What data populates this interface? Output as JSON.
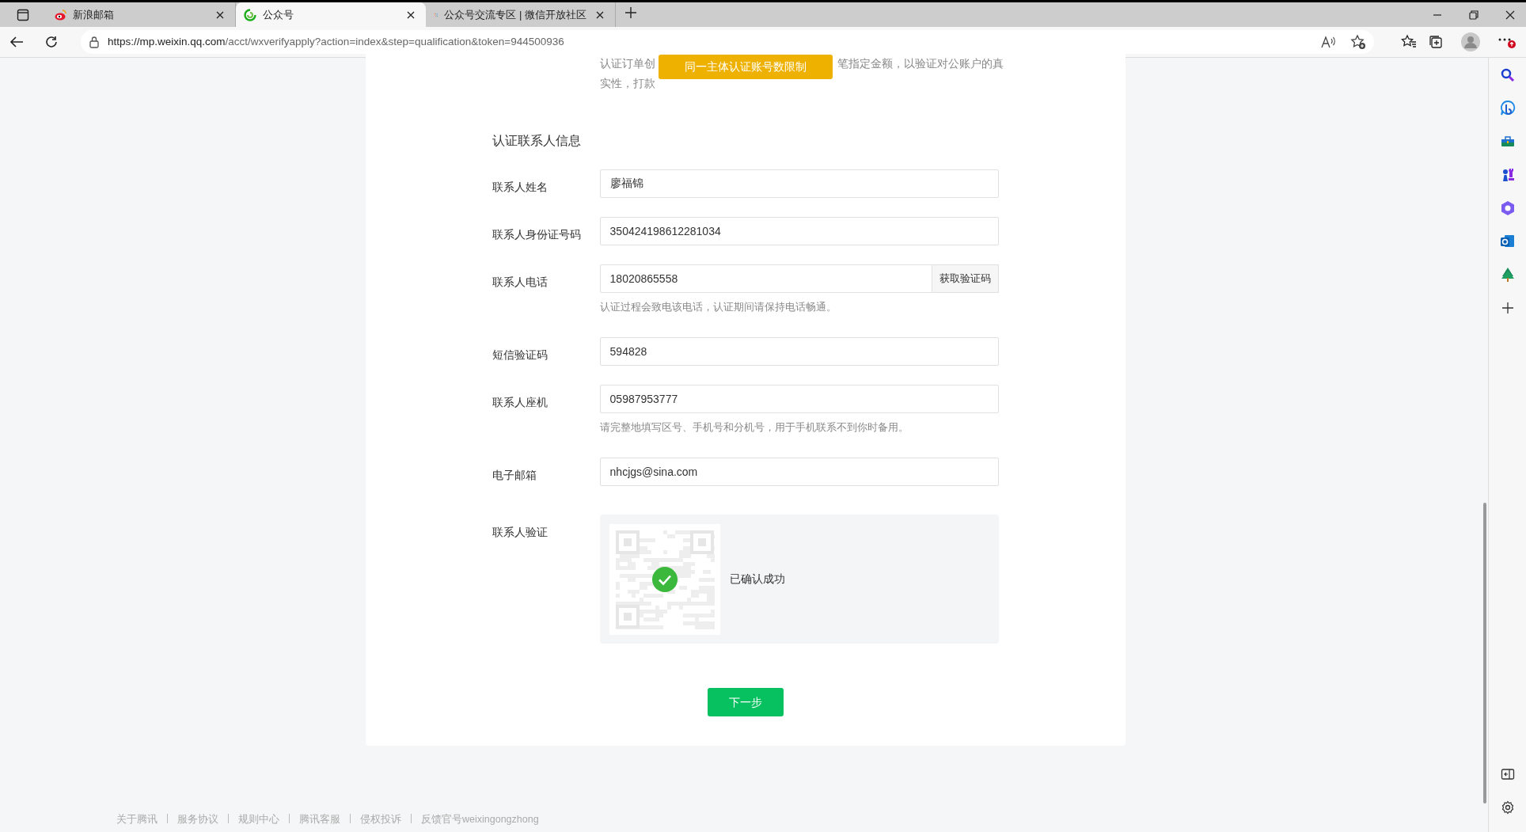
{
  "browser": {
    "tabs": [
      {
        "title": "新浪邮箱",
        "selected": false
      },
      {
        "title": "公众号",
        "selected": true
      },
      {
        "title": "公众号交流专区 | 微信开放社区",
        "selected": false
      }
    ],
    "url_host": "https://mp.weixin.qq.com",
    "url_path": "/acct/wxverifyapply?action=index&step=qualification&token=944500936"
  },
  "notice": {
    "line_1_start": "认证订单创",
    "line_1_end": "笔指定金额，以验证对公账户的真",
    "line_2_start": "实性，打款"
  },
  "tooltip": "同一主体认证账号数限制",
  "section_title": "认证联系人信息",
  "fields": [
    {
      "label": "联系人姓名",
      "value": "廖福锦"
    },
    {
      "label": "联系人身份证号码",
      "value": "350424198612281034"
    },
    {
      "label": "联系人电话",
      "value": "18020865558",
      "button": "获取验证码",
      "hint": "认证过程会致电该电话，认证期间请保持电话畅通。"
    },
    {
      "label": "短信验证码",
      "value": "594828"
    },
    {
      "label": "联系人座机",
      "value": "05987953777",
      "hint": "请完整地填写区号、手机号和分机号，用于手机联系不到你时备用。"
    },
    {
      "label": "电子邮箱",
      "value": "nhcjgs@sina.com"
    }
  ],
  "verification": {
    "label": "联系人验证",
    "status": "已确认成功",
    "confirmed": true
  },
  "next_button": "下一步",
  "footer_links": [
    "关于腾讯",
    "服务协议",
    "规则中心",
    "腾讯客服",
    "侵权投诉",
    "反馈官号weixingongzhong"
  ]
}
